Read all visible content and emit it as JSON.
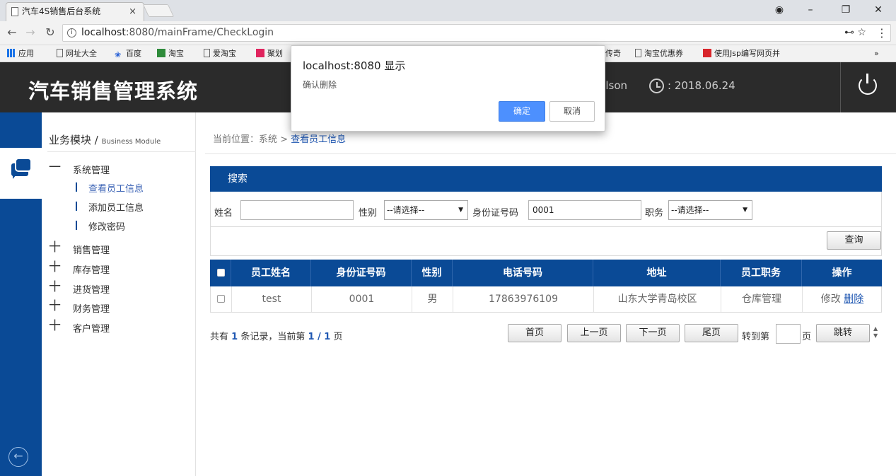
{
  "browser": {
    "tab_title": "汽车4S销售后台系统",
    "tab_close": "×",
    "url_host": "localhost",
    "url_rest": ":8080/mainFrame/CheckLogin",
    "bookmarks": [
      "应用",
      "网址大全",
      "百度",
      "淘宝",
      "爱淘宝",
      "聚划",
      "传奇",
      "淘宝优惠券",
      "使用Jsp编写网页并"
    ],
    "more": "»"
  },
  "header": {
    "title": "汽车销售管理系统",
    "user": "illson",
    "date_prefix": ":",
    "date": "2018.06.24"
  },
  "sidebar": {
    "module_title": "业务模块",
    "module_title_sep": " / ",
    "module_title_en": "Business Module",
    "system_mgmt": "系统管理",
    "sub_items": [
      "查看员工信息",
      "添加员工信息",
      "修改密码"
    ],
    "menus": [
      "销售管理",
      "库存管理",
      "进货管理",
      "财务管理",
      "客户管理"
    ],
    "minus": "一",
    "plus": "十"
  },
  "breadcrumb": {
    "prefix": "当前位置：系统 > ",
    "current": "查看员工信息"
  },
  "search": {
    "panel_title": "搜索",
    "name_label": "姓名",
    "name_value": "",
    "gender_label": "性别",
    "gender_selected": "--请选择--",
    "id_label": "身份证号码",
    "id_value": "0001",
    "position_label": "职务",
    "position_selected": "--请选择--",
    "query_button": "查询"
  },
  "table": {
    "headers": [
      "员工姓名",
      "身份证号码",
      "性别",
      "电话号码",
      "地址",
      "员工职务",
      "操作"
    ],
    "rows": [
      {
        "name": "test",
        "id": "0001",
        "gender": "男",
        "phone": "17863976109",
        "address": "山东大学青岛校区",
        "position": "仓库管理",
        "edit": "修改",
        "delete": "删除"
      }
    ]
  },
  "pager": {
    "t1": "共有 ",
    "total": "1",
    "t2": " 条记录，当前第 ",
    "current": "1 / 1",
    "t3": " 页",
    "first": "首页",
    "prev": "上一页",
    "next": "下一页",
    "last": "尾页",
    "goto_label": "转到第",
    "page_label": "页",
    "jump": "跳转"
  },
  "dialog": {
    "title": "localhost:8080 显示",
    "message": "确认删除",
    "ok": "确定",
    "cancel": "取消"
  }
}
